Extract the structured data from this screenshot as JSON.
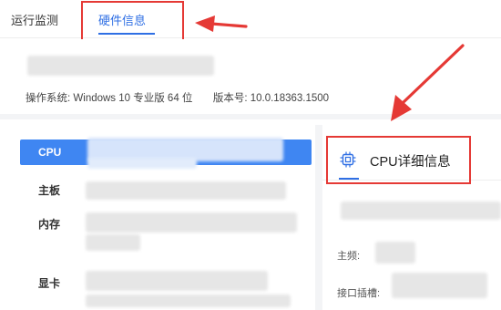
{
  "tabs": {
    "run_monitor": "运行监测",
    "hardware_info": "硬件信息"
  },
  "system": {
    "os_label": "操作系统:",
    "os_value": "Windows 10 专业版 64 位",
    "version_label": "版本号:",
    "version_value": "10.0.18363.1500"
  },
  "nav": {
    "cpu": "CPU",
    "motherboard": "主板",
    "memory": "内存",
    "gpu": "显卡"
  },
  "detail": {
    "title": "CPU详细信息",
    "fields": {
      "frequency": "主频:",
      "socket": "接口插槽:"
    }
  },
  "colors": {
    "accent": "#2f6fe4",
    "nav_active": "#3f86f2",
    "annotation": "#e53935"
  },
  "icons": {
    "cpu_detail": "cpu-chip-icon"
  }
}
